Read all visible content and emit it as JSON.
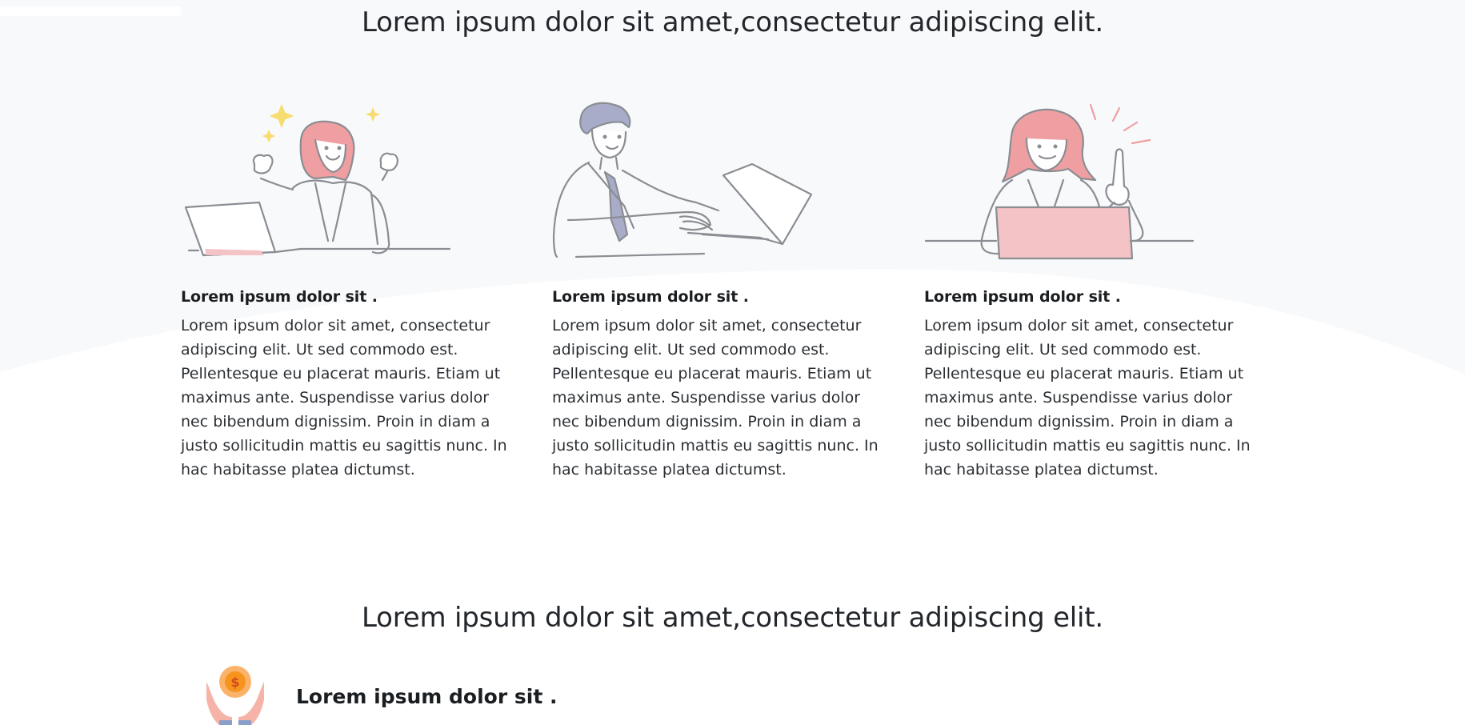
{
  "section1": {
    "title": "Lorem ipsum dolor sit amet,consectetur adipiscing elit."
  },
  "cards": [
    {
      "illustration": "woman-celebrating-at-laptop",
      "heading": "Lorem ipsum dolor sit .",
      "body": "Lorem ipsum dolor sit amet, consectetur adipiscing elit. Ut sed commodo est. Pellentesque eu placerat mauris. Etiam ut maximus ante. Suspendisse varius dolor nec bibendum dignissim. Proin in diam a justo sollicitudin mattis eu sagittis nunc. In hac habitasse platea dictumst."
    },
    {
      "illustration": "man-typing-on-laptop",
      "heading": "Lorem ipsum dolor sit .",
      "body": "Lorem ipsum dolor sit amet, consectetur adipiscing elit. Ut sed commodo est. Pellentesque eu placerat mauris. Etiam ut maximus ante. Suspendisse varius dolor nec bibendum dignissim. Proin in diam a justo sollicitudin mattis eu sagittis nunc. In hac habitasse platea dictumst."
    },
    {
      "illustration": "woman-idea-at-laptop",
      "heading": "Lorem ipsum dolor sit .",
      "body": "Lorem ipsum dolor sit amet, consectetur adipiscing elit. Ut sed commodo est. Pellentesque eu placerat mauris. Etiam ut maximus ante. Suspendisse varius dolor nec bibendum dignissim. Proin in diam a justo sollicitudin mattis eu sagittis nunc. In hac habitasse platea dictumst."
    }
  ],
  "section2": {
    "title": "Lorem ipsum dolor sit amet,consectetur adipiscing elit.",
    "feature": {
      "icon": "hands-holding-coin-icon",
      "heading": "Lorem ipsum dolor sit ."
    }
  },
  "colors": {
    "background_tint": "#f8f9fb",
    "line_art": "#8a8d92",
    "accent_pink": "#f4c3c6",
    "hair_pink": "#ef9fa2",
    "hair_blue": "#a9acc9",
    "sparkle_yellow": "#f7dc6f",
    "coin_orange": "#f7941d"
  }
}
